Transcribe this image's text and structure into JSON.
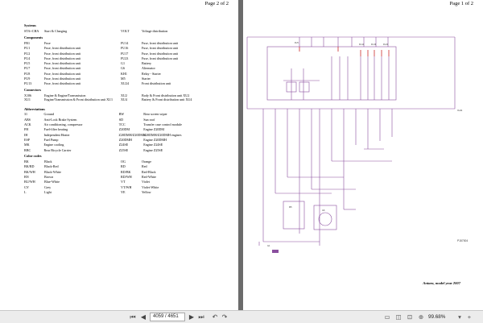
{
  "left_page": {
    "page_label": "Page 2 of 2",
    "systems": {
      "heading": "Systems",
      "rows": [
        [
          "STA+CHA",
          "Start & Charging",
          "VOLT",
          "Voltage distribution"
        ]
      ]
    },
    "components": {
      "heading": "Components",
      "rows": [
        [
          "FB1",
          "Fuse",
          "FU14",
          "Fuse, front distribution unit"
        ],
        [
          "FU1",
          "Fuse, front distribution unit",
          "FU16",
          "Fuse, front distribution unit"
        ],
        [
          "FU2",
          "Fuse, front distribution unit",
          "FU17",
          "Fuse, front distribution unit"
        ],
        [
          "FU4",
          "Fuse, front distribution unit",
          "FU23",
          "Fuse, front distribution unit"
        ],
        [
          "FU5",
          "Fuse, front distribution unit",
          "G1",
          "Battery"
        ],
        [
          "FU7",
          "Fuse, front distribution unit",
          "G6",
          "Alternator"
        ],
        [
          "FU8",
          "Fuse, front distribution unit",
          "KH1",
          "Relay - Starter"
        ],
        [
          "FU9",
          "Fuse, front distribution unit",
          "M5",
          "Starter"
        ],
        [
          "FU13",
          "Fuse, front distribution unit",
          "XU24",
          "Front distribution unit"
        ]
      ]
    },
    "connectors": {
      "heading": "Connectors",
      "rows": [
        [
          "X106",
          "Engine & Engine/Transmission",
          "XU2",
          "Body & Front distribution unit XU2"
        ],
        [
          "XU1",
          "Engine/Transmission & Front distribution unit XU1",
          "XU4",
          "Battery & Front distribution unit XU4"
        ]
      ]
    },
    "abbreviations": {
      "heading": "Abbreviations",
      "rows": [
        [
          "31",
          "Ground",
          "RW",
          "Rear screen wiper"
        ],
        [
          "ABS",
          "Anti-Lock Brake System",
          "SD",
          "Sun roof"
        ],
        [
          "ACK",
          "Air conditioning, compressor",
          "TCC",
          "Transfer case control module"
        ],
        [
          "FH",
          "Fuel-filter heating",
          "Z20DM",
          "Engine Z20DM"
        ],
        [
          "IH",
          "Independent Heater",
          "Z20DMH/Z20DMH",
          "Z20DMH/Z20DMH engines"
        ],
        [
          "ESP",
          "Fuel Pump",
          "Z20DMH",
          "Engine Z20DMH"
        ],
        [
          "MK",
          "Engine cooling",
          "Z24SE",
          "Engine Z24SE"
        ],
        [
          "RBC",
          "Rear Bicycle Carrier",
          "Z25SE",
          "Engine Z25SE"
        ]
      ]
    },
    "color_codes": {
      "heading": "Color codes",
      "rows": [
        [
          "BK",
          "Black",
          "OG",
          "Orange"
        ],
        [
          "BK/RD",
          "Black-Red",
          "RD",
          "Red"
        ],
        [
          "BK/WH",
          "Black-White",
          "RD/BK",
          "Red-Black"
        ],
        [
          "BN",
          "Brown",
          "RD/WH",
          "Red-White"
        ],
        [
          "BU/WH",
          "Blue-White",
          "VT",
          "Violet"
        ],
        [
          "GY",
          "Grey",
          "VT/WH",
          "Violet-White"
        ],
        [
          "L",
          "Light",
          "YE",
          "Yellow"
        ]
      ]
    }
  },
  "right_page": {
    "page_label": "Page 1 of 2",
    "footer_title": "Antara, model year 2007",
    "diagram_code": "P157004"
  },
  "toolbar": {
    "current_page": "4059",
    "total_pages": "/ 4651",
    "zoom": "99.68%",
    "icons": [
      "first-page-icon",
      "previous-page-icon",
      "next-page-icon",
      "last-page-icon",
      "back-icon",
      "forward-icon",
      "single-page-icon",
      "two-page-icon",
      "fit-page-icon",
      "zoom-icon"
    ]
  },
  "colors": {
    "wire_purple": "#8a4f9e",
    "fuse_red": "#cc2a2a",
    "viewer_background": "#6b6b6b",
    "toolbar_background": "#ececec"
  }
}
